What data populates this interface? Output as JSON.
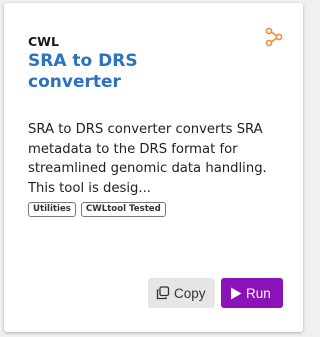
{
  "card": {
    "type_label": "CWL",
    "title": "SRA to DRS converter",
    "description": "SRA to DRS converter converts SRA metadata to the DRS format for streamlined genomic data handling. This tool is desig...",
    "tags": [
      "Utilities",
      "CWLtool Tested"
    ],
    "workflow_icon": "workflow-icon",
    "actions": {
      "copy_label": "Copy",
      "copy_icon": "copy-icon",
      "run_label": "Run",
      "run_icon": "play-icon"
    }
  },
  "colors": {
    "title": "#2a72bf",
    "workflow_icon": "#e8903a",
    "run_button": "#8b12b8",
    "copy_button": "#e6e6e6"
  }
}
